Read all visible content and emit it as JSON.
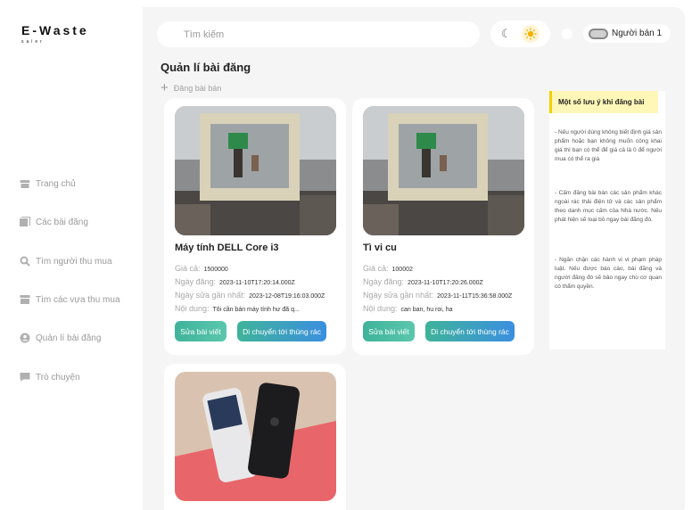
{
  "brand": {
    "title": "E-Waste",
    "subtitle": "saler"
  },
  "sidebar": {
    "items": [
      {
        "label": "Trang chủ",
        "icon": "store-icon"
      },
      {
        "label": "Các bài đăng",
        "icon": "posts-icon"
      },
      {
        "label": "Tìm người thu mua",
        "icon": "search-icon"
      },
      {
        "label": "Tìm các vựa thu mua",
        "icon": "warehouse-icon"
      },
      {
        "label": "Quản lí bài đăng",
        "icon": "user-circle-icon"
      },
      {
        "label": "Trò chuyện",
        "icon": "chat-icon"
      }
    ]
  },
  "header": {
    "search_placeholder": "Tìm kiếm",
    "user_name": "Người bán 1"
  },
  "main": {
    "title": "Quản lí bài đăng",
    "add_label": "Đăng bài bán",
    "field_labels": {
      "price": "Giá cả:",
      "posted": "Ngày đăng:",
      "updated": "Ngày sửa gần nhất:",
      "content": "Nội dung:"
    },
    "buttons": {
      "edit": "Sửa bài viết",
      "trash": "Di chuyển tới thùng rác"
    },
    "posts": [
      {
        "title": "Máy tính DELL Core i3",
        "price": "1500000",
        "posted": "2023-11-10T17:20:14.000Z",
        "updated": "2023-12-08T19:16:03.000Z",
        "content": "Tôi cần bán máy tính hư đã q..."
      },
      {
        "title": "Tì vi cu",
        "price": "100002",
        "posted": "2023-11-10T17:20:26.000Z",
        "updated": "2023-11-11T15:36:58.000Z",
        "content": "can ban, hu roi, ha"
      },
      {
        "title": "",
        "price": "",
        "posted": "",
        "updated": "",
        "content": ""
      }
    ]
  },
  "notes": {
    "title": "Một số lưu ý khi đăng bài",
    "items": [
      "- Nếu người dùng không biết định giá sản phẩm hoặc bạn không muốn công khai giá thì bạn có thể để giá cả là 0 để người mua có thể ra giá",
      "- Cấm đăng bài bán các sản phẩm khác ngoài rác thải điện tử và các sản phẩm theo danh mục cấm của Nhà nước. Nếu phát hiện sẽ loại bỏ ngay bài đăng đó.",
      "- Ngăn chặn các hành vi vi phạm pháp luật. Nếu được báo cáo, bài đăng và người đăng đó sẽ bảo ngay cho cơ quan có thẩm quyền."
    ]
  },
  "colors": {
    "accent_green": "#3fb39a",
    "accent_blue": "#3b8fe0",
    "note_yellow": "#fff7b8",
    "note_border": "#f2d000"
  }
}
